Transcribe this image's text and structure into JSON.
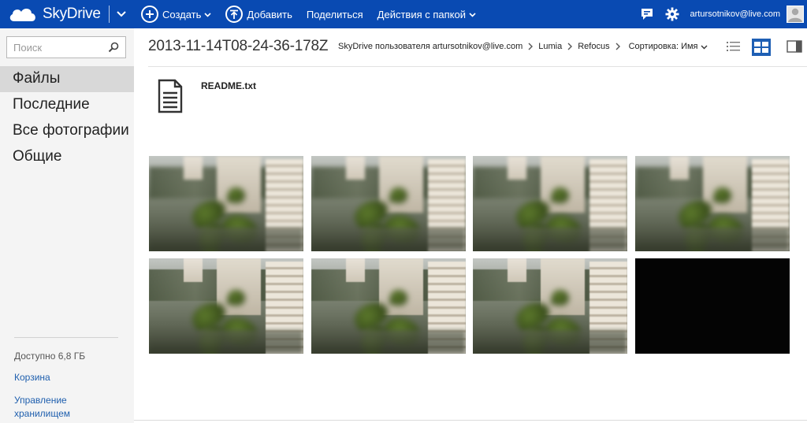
{
  "app": {
    "name": "SkyDrive",
    "brand_color": "#094ab2"
  },
  "topbar": {
    "create_label": "Создать",
    "upload_label": "Добавить",
    "share_label": "Поделиться",
    "folder_actions_label": "Действия с папкой",
    "user_email": "artursotnikov@live.com",
    "icons": [
      "feedback-icon",
      "gear-icon",
      "avatar"
    ]
  },
  "sidebar": {
    "search_placeholder": "Поиск",
    "nav": [
      {
        "label": "Файлы",
        "active": true
      },
      {
        "label": "Последние",
        "active": false
      },
      {
        "label": "Все фотографии",
        "active": false
      },
      {
        "label": "Общие",
        "active": false
      }
    ],
    "storage_text": "Доступно 6,8 ГБ",
    "recycle_bin": "Корзина",
    "manage_storage": "Управление хранилищем"
  },
  "main": {
    "folder_title": "2013-11-14T08-24-36-178Z",
    "breadcrumb": [
      "SkyDrive пользователя artursotnikov@live.com",
      "Lumia",
      "Refocus"
    ],
    "sort_label": "Сортировка: Имя",
    "view_mode": "thumbnails",
    "files": [
      {
        "name": "README.txt",
        "type": "text-file-icon"
      }
    ],
    "photos": [
      {
        "style": "blurred"
      },
      {
        "style": "blurred"
      },
      {
        "style": "blurred"
      },
      {
        "style": "blurred"
      },
      {
        "style": "sharp"
      },
      {
        "style": "sharp"
      },
      {
        "style": "sharp"
      },
      {
        "style": "dark"
      }
    ]
  }
}
